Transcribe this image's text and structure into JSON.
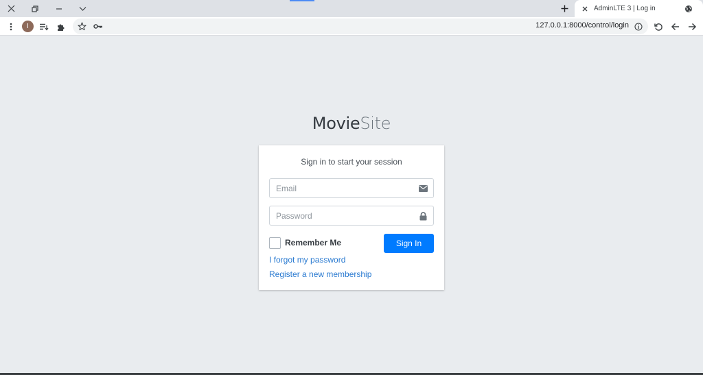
{
  "browser": {
    "tab": {
      "title": "AdminLTE 3 | Log in"
    },
    "toolbar": {
      "profile_initial": "I",
      "url": "127.0.0.1:8000/control/login"
    },
    "icons": {
      "close": "close-icon",
      "restore": "restore-icon",
      "minimize": "minimize-icon",
      "tab_search": "chevron-down-icon",
      "new_tab": "plus-icon",
      "tab_close": "close-icon",
      "tab_favicon": "globe-icon",
      "menu": "kebab-menu-icon",
      "reading_list": "reading-list-icon",
      "extensions": "puzzle-icon",
      "bookmark": "star-icon",
      "password": "key-icon",
      "site_info": "info-icon",
      "reload": "reload-icon",
      "back": "arrow-left-icon",
      "forward": "arrow-right-icon"
    }
  },
  "page": {
    "logo": {
      "bold": "Movie",
      "light": "Site"
    },
    "login": {
      "message": "Sign in to start your session",
      "email": {
        "placeholder": "Email",
        "value": "",
        "icon": "envelope-icon"
      },
      "password": {
        "placeholder": "Password",
        "value": "",
        "icon": "lock-icon"
      },
      "remember_label": "Remember Me",
      "remember_checked": false,
      "signin_label": "Sign In",
      "forgot_link": "I forgot my password",
      "register_link": "Register a new membership"
    },
    "colors": {
      "background": "#e9ecef",
      "primary": "#007bff",
      "link": "#2b7bd1"
    }
  }
}
